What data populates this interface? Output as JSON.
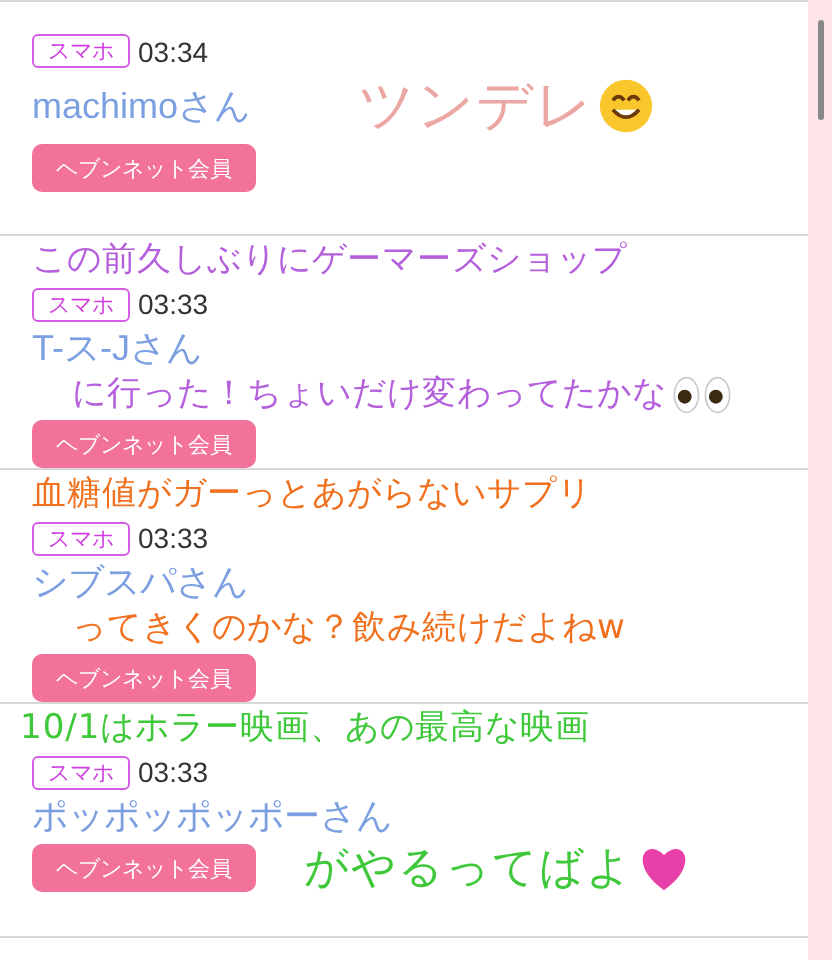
{
  "posts": [
    {
      "device": "スマホ",
      "time": "03:34",
      "name": "machimoさん",
      "member_button": "ヘブンネット会員",
      "caption": {
        "kind": "smile",
        "color": "#eba7a3",
        "lines": [
          "ツンデレ"
        ]
      }
    },
    {
      "device": "スマホ",
      "time": "03:33",
      "name": "T-ス-Jさん",
      "member_button": "ヘブンネット会員",
      "caption": {
        "kind": "eyes",
        "color": "#b45fdc",
        "lines": [
          "この前久しぶりにゲーマーズショップ",
          "に行った！ちょいだけ変わってたかな"
        ]
      }
    },
    {
      "device": "スマホ",
      "time": "03:33",
      "name": "シブスパさん",
      "member_button": "ヘブンネット会員",
      "caption": {
        "kind": "plain",
        "color": "#f0701e",
        "lines": [
          "血糖値がガーっとあがらないサプリ",
          "ってきくのかな？飲み続けだよねw"
        ]
      }
    },
    {
      "device": "スマホ",
      "time": "03:33",
      "name": "ポッポッポッポーさん",
      "member_button": "ヘブンネット会員",
      "caption": {
        "kind": "heart",
        "color": "#3ec83a",
        "lines": [
          "10/1はホラー映画、あの最高な映画",
          "がやるってばよ"
        ]
      }
    }
  ]
}
